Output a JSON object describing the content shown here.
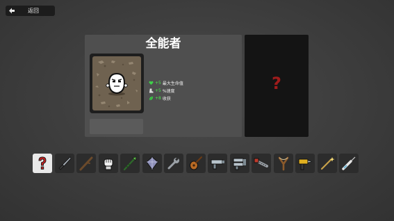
{
  "header": {
    "back_label": "返回",
    "back_icon": "arrow-left-icon"
  },
  "character": {
    "name": "全能者",
    "portrait_icon": "character-portrait-icon",
    "stats": [
      {
        "icon": "heart-icon",
        "value": "+5",
        "label": "最大生命值",
        "color": "#48e84a"
      },
      {
        "icon": "boot-icon",
        "value": "+5",
        "label": "%速度",
        "color": "#48e84a"
      },
      {
        "icon": "leaf-icon",
        "value": "+8",
        "label": "收获",
        "color": "#48e84a"
      }
    ]
  },
  "weapon_preview": {
    "glyph": "?",
    "color": "#a01c1c"
  },
  "weapons": [
    {
      "icon": "random-question-icon",
      "selected": true
    },
    {
      "icon": "knife-icon"
    },
    {
      "icon": "stick-icon"
    },
    {
      "icon": "fist-icon"
    },
    {
      "icon": "spear-icon"
    },
    {
      "icon": "crystal-shard-icon"
    },
    {
      "icon": "wrench-icon"
    },
    {
      "icon": "lute-icon"
    },
    {
      "icon": "blaster-gun-icon"
    },
    {
      "icon": "double-blaster-icon"
    },
    {
      "icon": "chainsaw-icon"
    },
    {
      "icon": "slingshot-icon"
    },
    {
      "icon": "drill-icon"
    },
    {
      "icon": "magic-wand-icon"
    },
    {
      "icon": "syringe-icon"
    }
  ],
  "colors": {
    "background": "#3d3d3d",
    "panel": "#4f4f4f",
    "dark_panel": "#141414",
    "positive": "#48e84a"
  }
}
